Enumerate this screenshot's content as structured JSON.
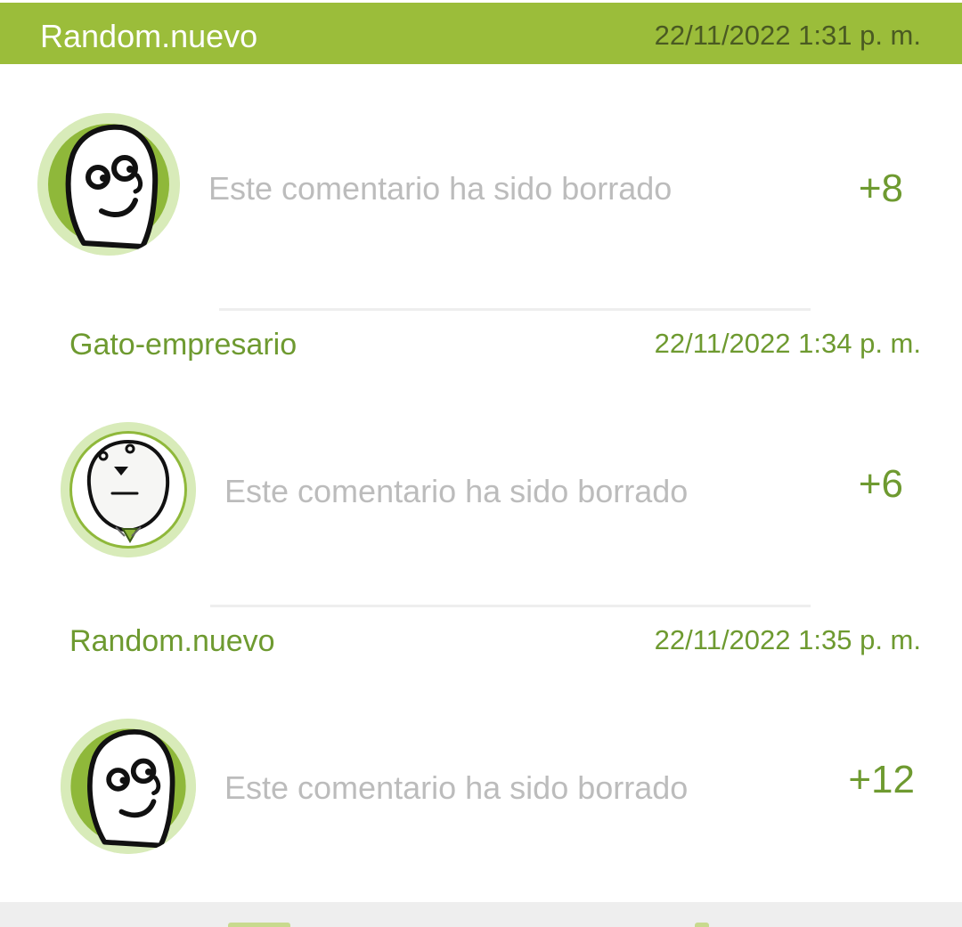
{
  "header": {
    "user": "Random.nuevo",
    "timestamp": "22/11/2022 1:31 p. m.",
    "color": "#9bbd3a"
  },
  "comments": [
    {
      "avatar": "smiling-face-avatar",
      "text": "Este comentario ha sido borrado",
      "score": "+8"
    },
    {
      "user": "Gato-empresario",
      "timestamp": "22/11/2022 1:34 p. m.",
      "avatar": "businessman-cat-avatar",
      "text": "Este comentario ha sido borrado",
      "score": "+6"
    },
    {
      "user": "Random.nuevo",
      "timestamp": "22/11/2022 1:35 p. m.",
      "avatar": "smiling-face-avatar",
      "text": "Este comentario ha sido borrado",
      "score": "+12"
    }
  ],
  "colors": {
    "accent_green": "#6e9a30",
    "deleted_text": "#bcbcbc",
    "avatar_ring": "#d8ebb9"
  }
}
